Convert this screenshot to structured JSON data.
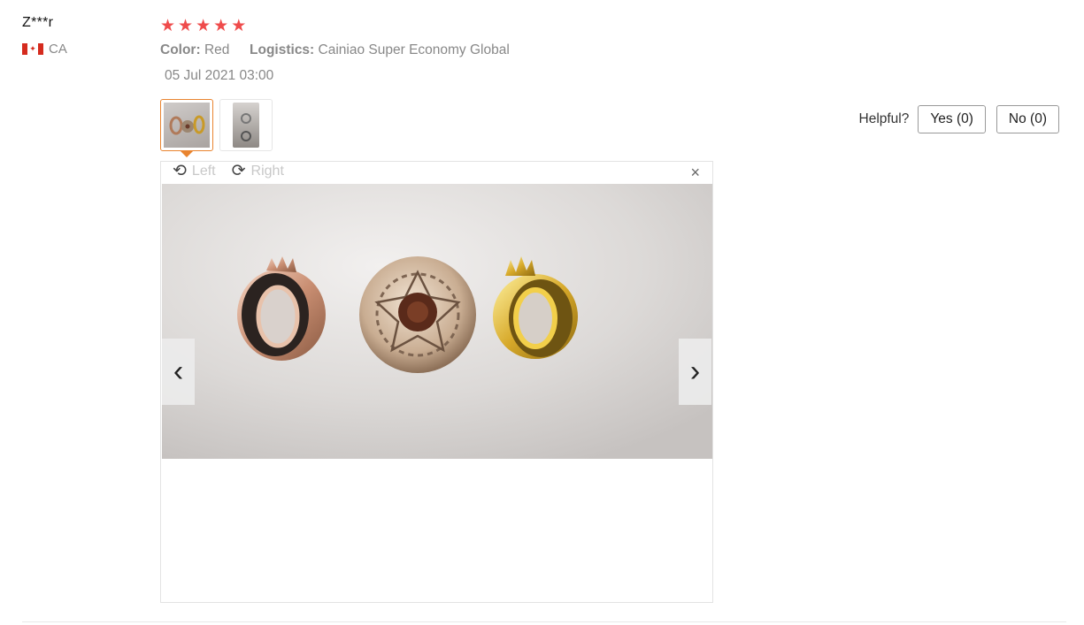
{
  "reviewer": {
    "name": "Z***r",
    "country_code": "CA"
  },
  "review": {
    "rating": 5,
    "stars": [
      "★",
      "★",
      "★",
      "★",
      "★"
    ],
    "color_label": "Color:",
    "color_value": "Red",
    "logistics_label": "Logistics:",
    "logistics_value": "Cainiao Super Economy Global",
    "date": "05 Jul 2021 03:00"
  },
  "helpful": {
    "label": "Helpful?",
    "yes": "Yes (0)",
    "no": "No (0)"
  },
  "viewer": {
    "rotate_left": "Left",
    "rotate_right": "Right",
    "close_glyph": "×",
    "prev_glyph": "‹",
    "next_glyph": "›"
  },
  "colors": {
    "star": "#ef4b4b",
    "thumb_active_border": "#e9842f"
  },
  "icons": [
    "canada-flag-icon",
    "star-icon",
    "rotate-left-icon",
    "rotate-right-icon",
    "close-icon",
    "chevron-left-icon",
    "chevron-right-icon"
  ]
}
